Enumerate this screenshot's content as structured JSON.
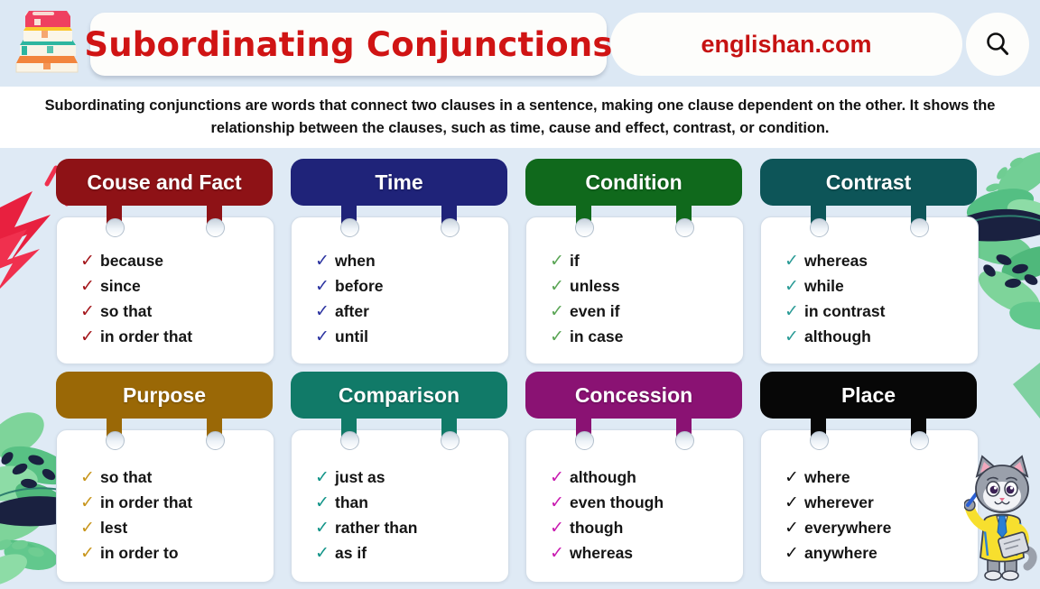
{
  "header": {
    "title": "Subordinating Conjunctions",
    "brand": "englishan.com",
    "search_icon": "search-icon",
    "books_icon": "stack-of-books-icon"
  },
  "description": "Subordinating conjunctions are words that connect two clauses in a sentence, making one clause dependent on the other. It shows the relationship between the clauses, such as time, cause and effect, contrast, or condition.",
  "colors": {
    "page_background": "#dfeaf5",
    "header_background": "#dce8f4",
    "description_background": "#ffffff",
    "title_text": "#d01414",
    "brand_text": "#c61212",
    "card_background": "#ffffff"
  },
  "cards": [
    {
      "title": "Couse and Fact",
      "header_color": "#8e1216",
      "check_color": "#a3151a",
      "items": [
        "because",
        "since",
        "so that",
        "in order that"
      ]
    },
    {
      "title": "Time",
      "header_color": "#1f2379",
      "check_color": "#2b33a0",
      "items": [
        "when",
        "before",
        "after",
        "until"
      ]
    },
    {
      "title": "Condition",
      "header_color": "#10691c",
      "check_color": "#5aa555",
      "items": [
        "if",
        "unless",
        "even if",
        "in case"
      ]
    },
    {
      "title": "Contrast",
      "header_color": "#0d5558",
      "check_color": "#2a9b96",
      "items": [
        "whereas",
        "while",
        "in contrast",
        "although"
      ]
    },
    {
      "title": "Purpose",
      "header_color": "#9a6806",
      "check_color": "#c8951b",
      "items": [
        "so that",
        "in order that",
        "lest",
        "in order to"
      ]
    },
    {
      "title": "Comparison",
      "header_color": "#117a68",
      "check_color": "#119488",
      "items": [
        "just as",
        "than",
        "rather than",
        "as if"
      ]
    },
    {
      "title": "Concession",
      "header_color": "#8a1273",
      "check_color": "#c91ab0",
      "items": [
        "although",
        "even though",
        "though",
        "whereas"
      ]
    },
    {
      "title": "Place",
      "header_color": "#070707",
      "check_color": "#111111",
      "items": [
        "where",
        "wherever",
        "everywhere",
        "anywhere"
      ]
    }
  ],
  "decorations": {
    "lightning": "lightning-bolt-decor",
    "leaves_left": "leaves-decor-left",
    "leaves_right": "leaves-decor-right",
    "mascot": "cat-mascot-with-pen"
  }
}
